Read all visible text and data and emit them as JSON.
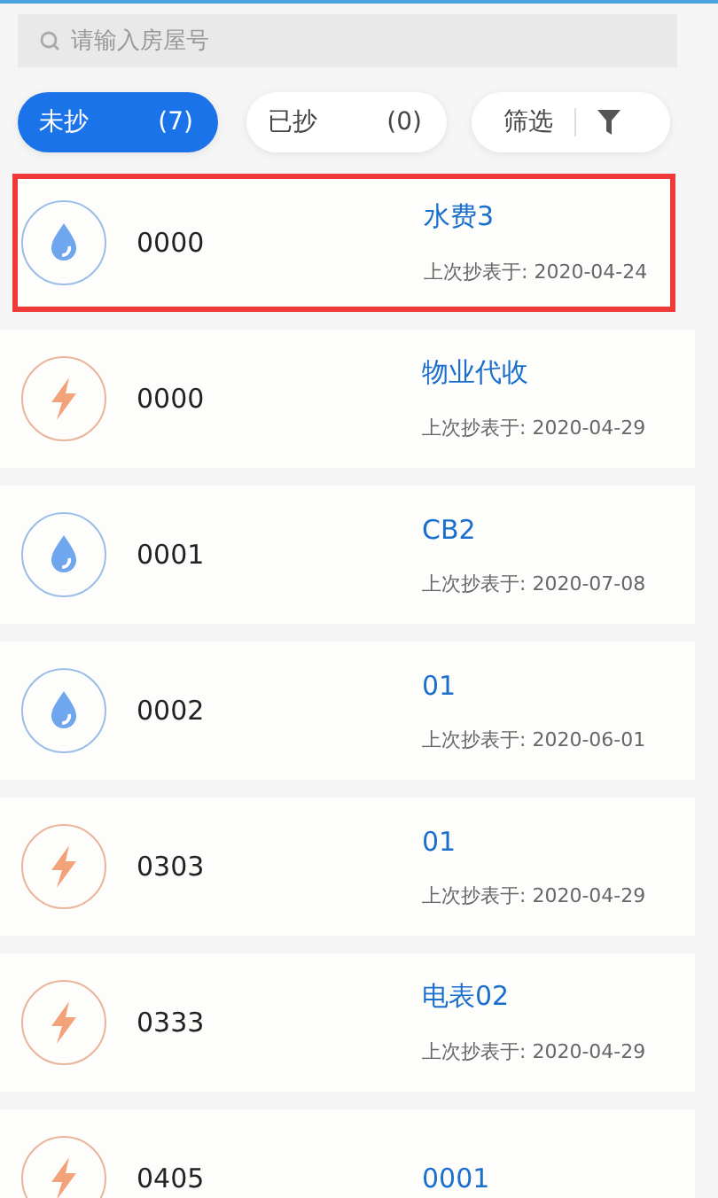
{
  "search": {
    "placeholder": "请输入房屋号"
  },
  "tabs": [
    {
      "label": "未抄",
      "count": "(7)",
      "selected": true
    },
    {
      "label": "已抄",
      "count": "(0)",
      "selected": false
    }
  ],
  "filter": {
    "label": "筛选"
  },
  "meters": [
    {
      "kind": "water",
      "number": "0000",
      "title": "水费3",
      "date": "上次抄表于: 2020-04-24",
      "selected": true
    },
    {
      "kind": "electric",
      "number": "0000",
      "title": "物业代收",
      "date": "上次抄表于: 2020-04-29",
      "selected": false
    },
    {
      "kind": "water",
      "number": "0001",
      "title": "CB2",
      "date": "上次抄表于: 2020-07-08",
      "selected": false
    },
    {
      "kind": "water",
      "number": "0002",
      "title": "01",
      "date": "上次抄表于: 2020-06-01",
      "selected": false
    },
    {
      "kind": "electric",
      "number": "0303",
      "title": "01",
      "date": "上次抄表于: 2020-04-29",
      "selected": false
    },
    {
      "kind": "electric",
      "number": "0333",
      "title": "电表02",
      "date": "上次抄表于: 2020-04-29",
      "selected": false
    },
    {
      "kind": "electric",
      "number": "0405",
      "title": "0001",
      "selected": false
    }
  ]
}
